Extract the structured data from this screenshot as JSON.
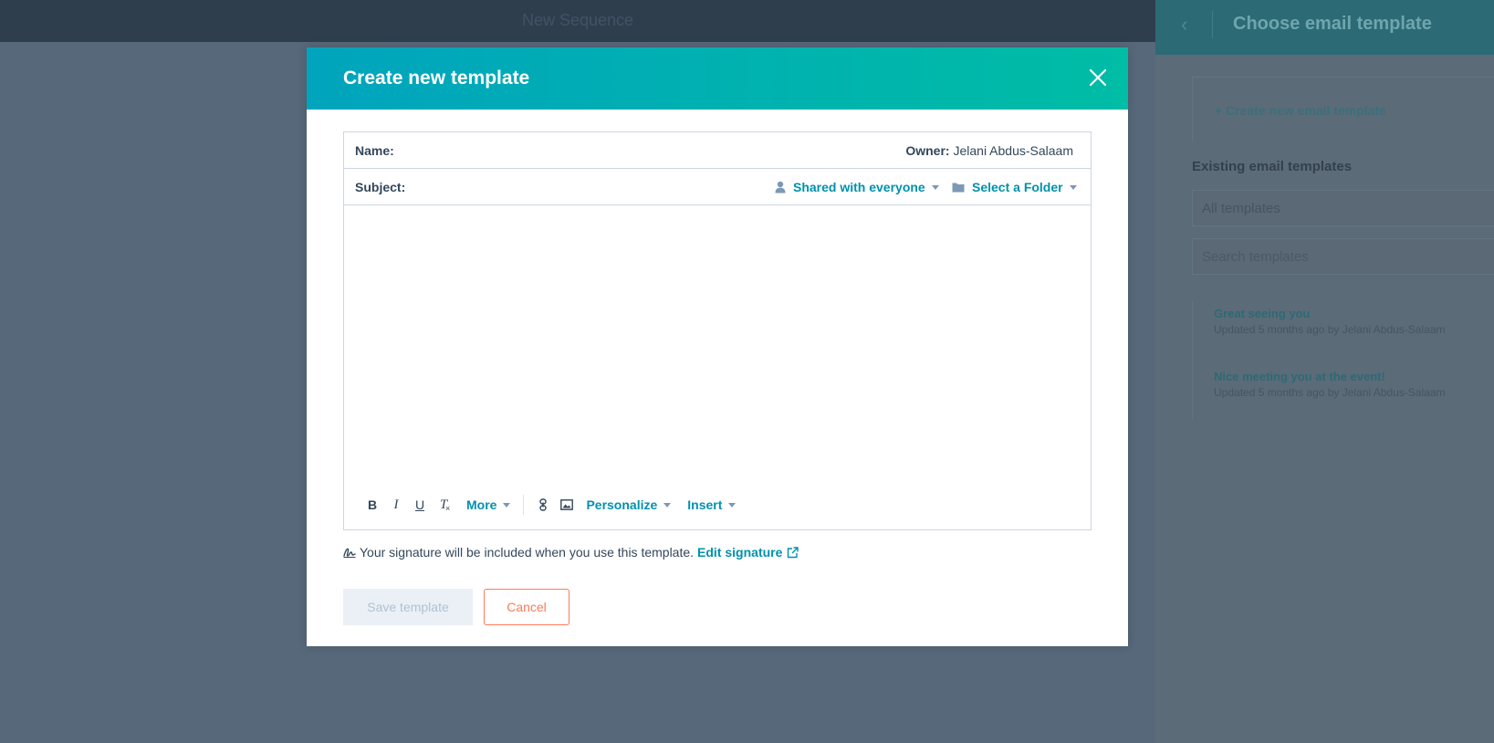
{
  "background": {
    "topbar_title": "New Sequence"
  },
  "panel": {
    "title": "Choose email template",
    "create_link": "+ Create new email template",
    "existing_heading": "Existing email templates",
    "filter_value": "All templates",
    "search_placeholder": "Search templates",
    "templates": [
      {
        "name": "Great seeing you",
        "meta": "Updated 5 months ago by Jelani Abdus-Salaam"
      },
      {
        "name": "Nice meeting you at the event!",
        "meta": "Updated 5 months ago by Jelani Abdus-Salaam"
      }
    ]
  },
  "modal": {
    "title": "Create new template",
    "name_label": "Name:",
    "owner_label": "Owner:",
    "owner_value": "Jelani Abdus-Salaam",
    "subject_label": "Subject:",
    "sharing": "Shared with everyone",
    "folder": "Select a Folder",
    "toolbar": {
      "bold": "B",
      "italic": "I",
      "underline": "U",
      "clear": "T",
      "more": "More",
      "personalize": "Personalize",
      "insert": "Insert"
    },
    "signature_text": "Your signature will be included when you use this template.",
    "edit_signature": "Edit signature",
    "save_label": "Save template",
    "cancel_label": "Cancel"
  },
  "colors": {
    "header_gradient_start": "#00a4bd",
    "header_gradient_end": "#00bda5",
    "link": "#0091ae",
    "cancel_accent": "#ff7a59",
    "overlay": "#5a6b79"
  }
}
